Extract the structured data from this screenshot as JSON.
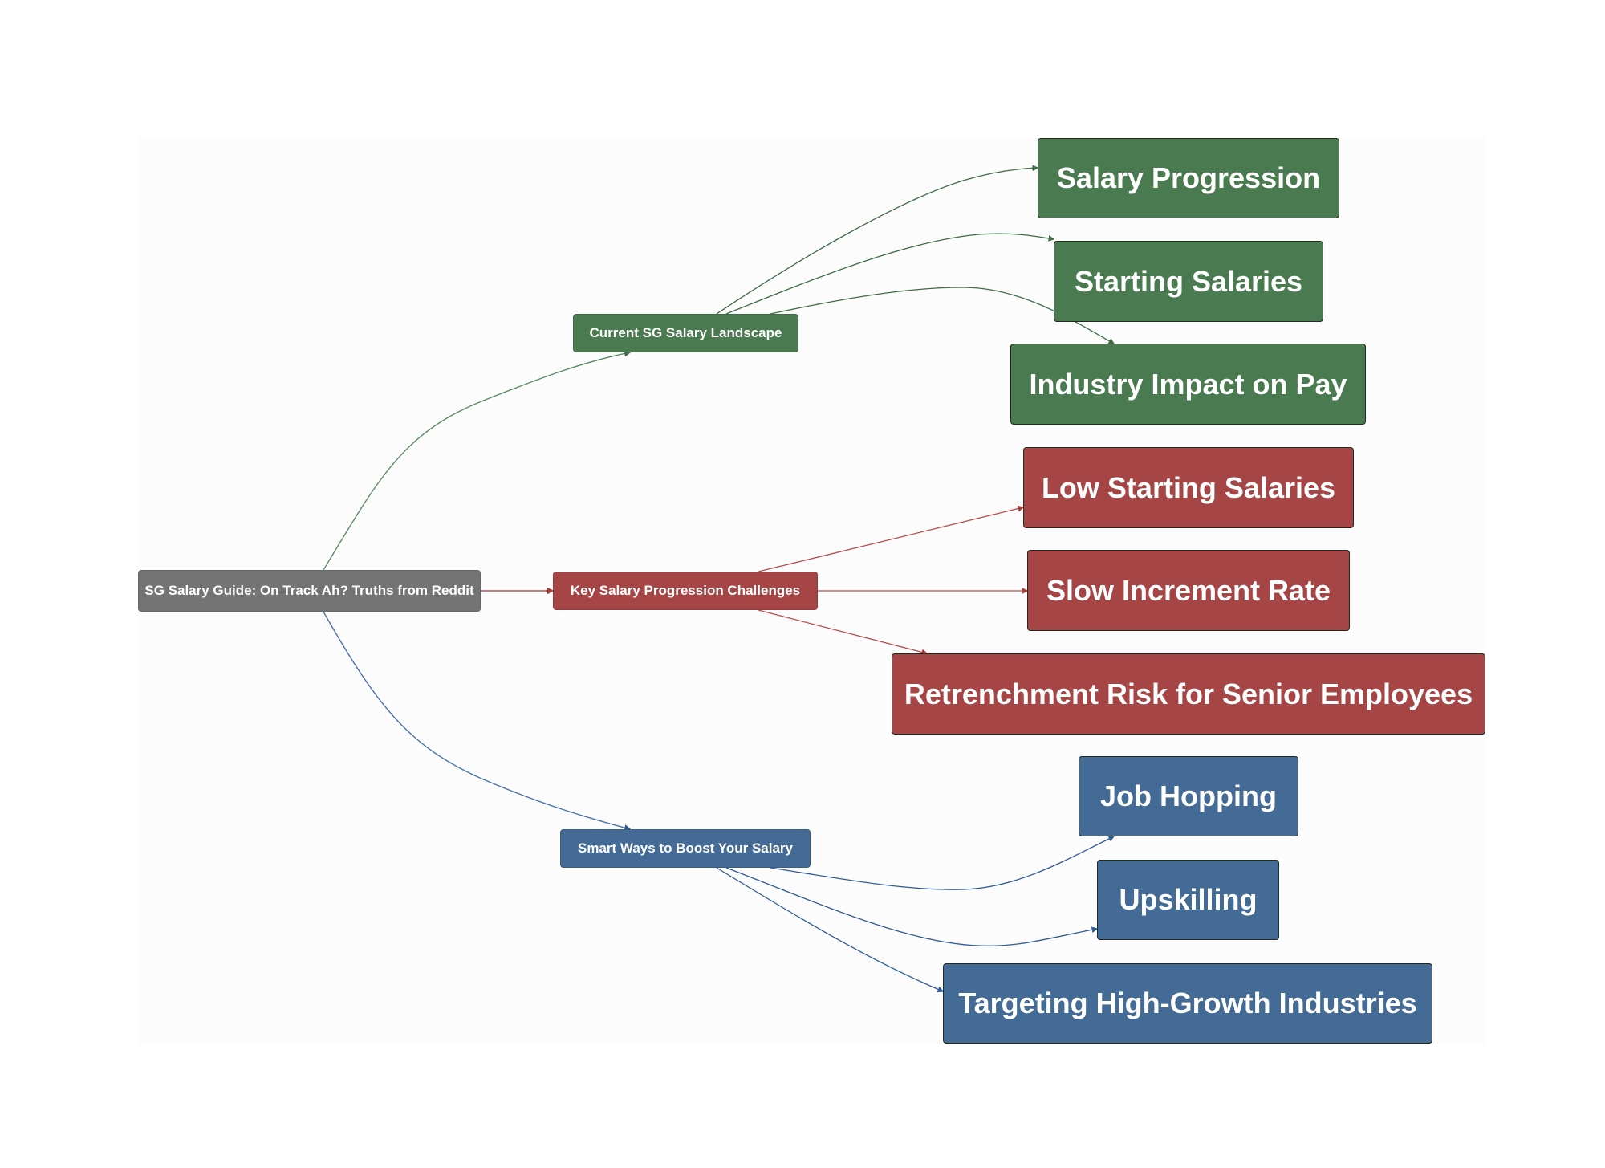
{
  "colors": {
    "root": "#747474",
    "landscape": "#4a7a50",
    "challenges": "#a64545",
    "boost": "#436b96",
    "panel": "#fcfcfc"
  },
  "root": {
    "label": "SG Salary Guide: On Track Ah? Truths from Reddit"
  },
  "branches": [
    {
      "id": "landscape",
      "label": "Current SG Salary Landscape",
      "children": [
        "Salary Progression",
        "Starting Salaries",
        "Industry Impact on Pay"
      ]
    },
    {
      "id": "challenges",
      "label": "Key Salary Progression Challenges",
      "children": [
        "Low Starting Salaries",
        "Slow Increment Rate",
        "Retrenchment Risk for Senior Employees"
      ]
    },
    {
      "id": "boost",
      "label": "Smart Ways to Boost Your Salary",
      "children": [
        "Job Hopping",
        "Upskilling",
        "Targeting High-Growth Industries"
      ]
    }
  ]
}
